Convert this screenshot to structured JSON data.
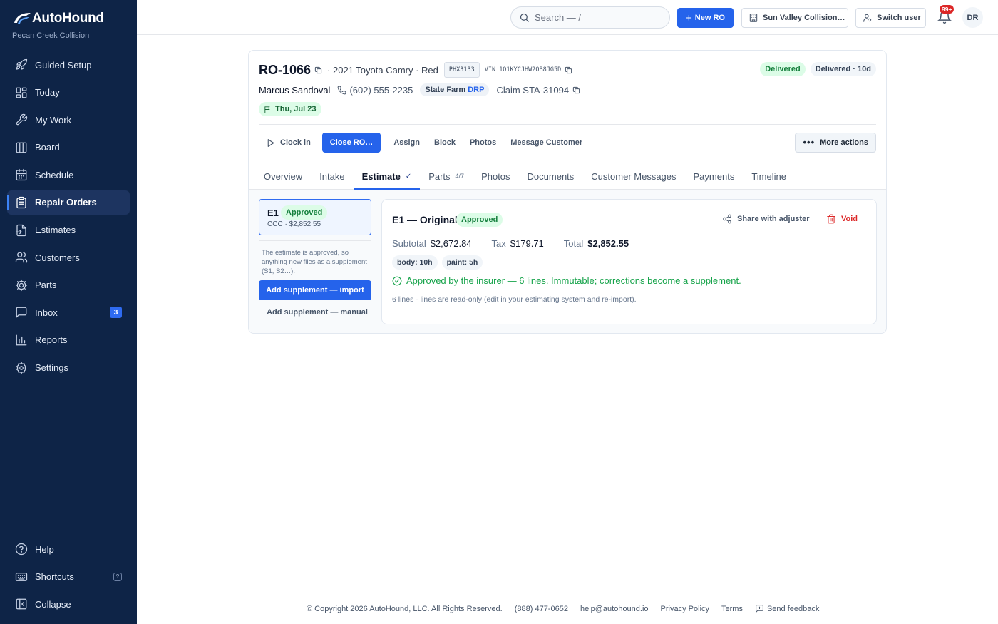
{
  "brand": {
    "name": "AutoHound",
    "shop": "Pecan Creek Collision"
  },
  "sidebar": {
    "items": [
      {
        "label": "Guided Setup",
        "icon": "rocket-icon"
      },
      {
        "label": "Today",
        "icon": "dashboard-icon"
      },
      {
        "label": "My Work",
        "icon": "wrench-icon"
      },
      {
        "label": "Board",
        "icon": "board-icon"
      },
      {
        "label": "Schedule",
        "icon": "calendar-icon"
      },
      {
        "label": "Repair Orders",
        "icon": "clipboard-icon",
        "active": true
      },
      {
        "label": "Estimates",
        "icon": "file-import-icon"
      },
      {
        "label": "Customers",
        "icon": "users-icon"
      },
      {
        "label": "Parts",
        "icon": "cog-icon"
      },
      {
        "label": "Inbox",
        "icon": "message-icon",
        "badge": "3"
      },
      {
        "label": "Reports",
        "icon": "bar-chart-icon"
      },
      {
        "label": "Settings",
        "icon": "settings-icon"
      }
    ],
    "bottom": [
      {
        "label": "Help",
        "icon": "help-icon"
      },
      {
        "label": "Shortcuts",
        "icon": "keyboard-icon",
        "badge": "?"
      },
      {
        "label": "Collapse",
        "icon": "collapse-icon"
      }
    ]
  },
  "topbar": {
    "search_placeholder": "Search — /",
    "new_ro": "New RO",
    "location": "Sun Valley Collision…",
    "switch_user": "Switch user",
    "notif_count": "99+",
    "avatar": "DR"
  },
  "ro": {
    "number": "RO-1066",
    "vehicle": "· 2021 Toyota Camry · Red",
    "plate": "PHX3133",
    "vin": "VIN 1O1KYCJHW2OB8JG5D",
    "status": "Delivered",
    "status_age": "Delivered · 10d",
    "customer": "Marcus Sandoval",
    "phone": "(602) 555-2235",
    "insurer": "State Farm",
    "insurer_tag": "DRP",
    "claim": "Claim STA-31094",
    "date": "Thu, Jul 23"
  },
  "actions": {
    "clock_in": "Clock in",
    "close_ro": "Close RO…",
    "assign": "Assign",
    "block": "Block",
    "photos": "Photos",
    "message": "Message Customer",
    "more": "More actions"
  },
  "tabs": [
    {
      "label": "Overview"
    },
    {
      "label": "Intake"
    },
    {
      "label": "Estimate",
      "active": true,
      "check": "✓"
    },
    {
      "label": "Parts",
      "count": "4/7"
    },
    {
      "label": "Photos"
    },
    {
      "label": "Documents"
    },
    {
      "label": "Customer Messages"
    },
    {
      "label": "Payments"
    },
    {
      "label": "Timeline"
    }
  ],
  "estimate_list": {
    "item": {
      "id": "E1",
      "status": "Approved",
      "sub": "CCC · $2,852.55"
    },
    "note": "The estimate is approved, so anything new files as a supplement (S1, S2…).",
    "import_btn": "Add supplement — import",
    "manual_btn": "Add supplement — manual"
  },
  "estimate_detail": {
    "title": "E1 — Original",
    "status": "Approved",
    "share": "Share with adjuster",
    "void": "Void",
    "subtotal_label": "Subtotal",
    "subtotal": "$2,672.84",
    "tax_label": "Tax",
    "tax": "$179.71",
    "total_label": "Total",
    "total": "$2,852.55",
    "hours": [
      "body: 10h",
      "paint: 5h"
    ],
    "approved_msg": "Approved by the insurer — 6 lines. Immutable; corrections become a supplement.",
    "lines_note": "6 lines · lines are read-only (edit in your estimating system and re-import)."
  },
  "footer": {
    "copyright": "© Copyright 2026 AutoHound, LLC. All Rights Reserved.",
    "phone": "(888) 477-0652",
    "email": "help@autohound.io",
    "privacy": "Privacy Policy",
    "terms": "Terms",
    "feedback": "Send feedback"
  },
  "colors": {
    "sidebar": "#0e2447",
    "accent": "#2563eb",
    "success": "#16a34a",
    "danger": "#dc2626"
  }
}
